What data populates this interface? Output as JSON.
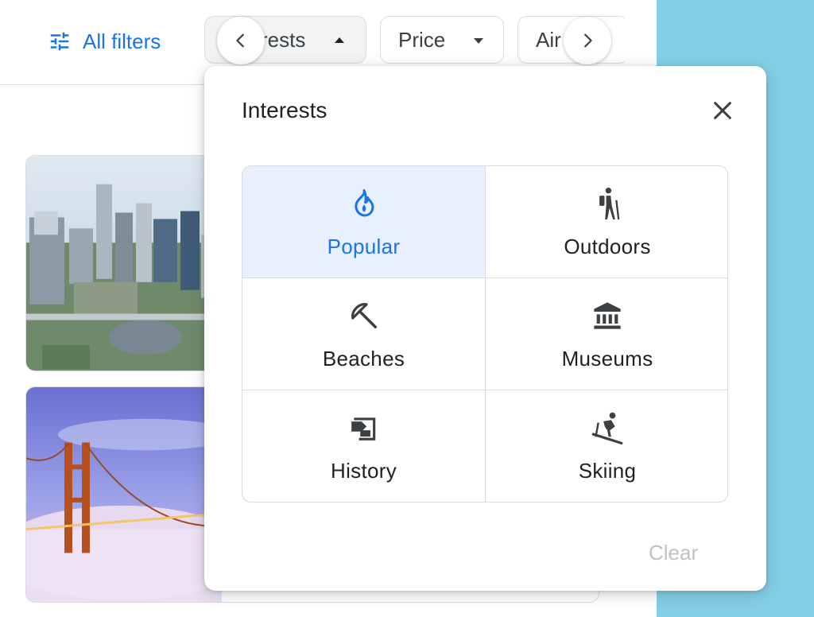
{
  "filters": {
    "all_filters_label": "All filters",
    "chips": [
      {
        "label": "Interests",
        "visible_text": "rests",
        "expanded": true
      },
      {
        "label": "Price",
        "visible_text": "Price"
      },
      {
        "label": "Airlines",
        "visible_text": "Air"
      }
    ]
  },
  "popup": {
    "title": "Interests",
    "options": [
      {
        "label": "Popular",
        "icon": "fire-icon",
        "selected": true
      },
      {
        "label": "Outdoors",
        "icon": "hiking-icon",
        "selected": false
      },
      {
        "label": "Beaches",
        "icon": "beach-umbrella-icon",
        "selected": false
      },
      {
        "label": "Museums",
        "icon": "museum-icon",
        "selected": false
      },
      {
        "label": "History",
        "icon": "history-icon",
        "selected": false
      },
      {
        "label": "Skiing",
        "icon": "skiing-icon",
        "selected": false
      }
    ],
    "clear_label": "Clear"
  },
  "cards": [
    {
      "image": "city-skyline-photo"
    },
    {
      "image": "golden-gate-bridge-photo"
    }
  ],
  "colors": {
    "accent": "#1a73e8",
    "selected_bg": "#e8f0fe",
    "side_panel": "#84cfe5",
    "disabled_text": "#bdc1c6"
  }
}
